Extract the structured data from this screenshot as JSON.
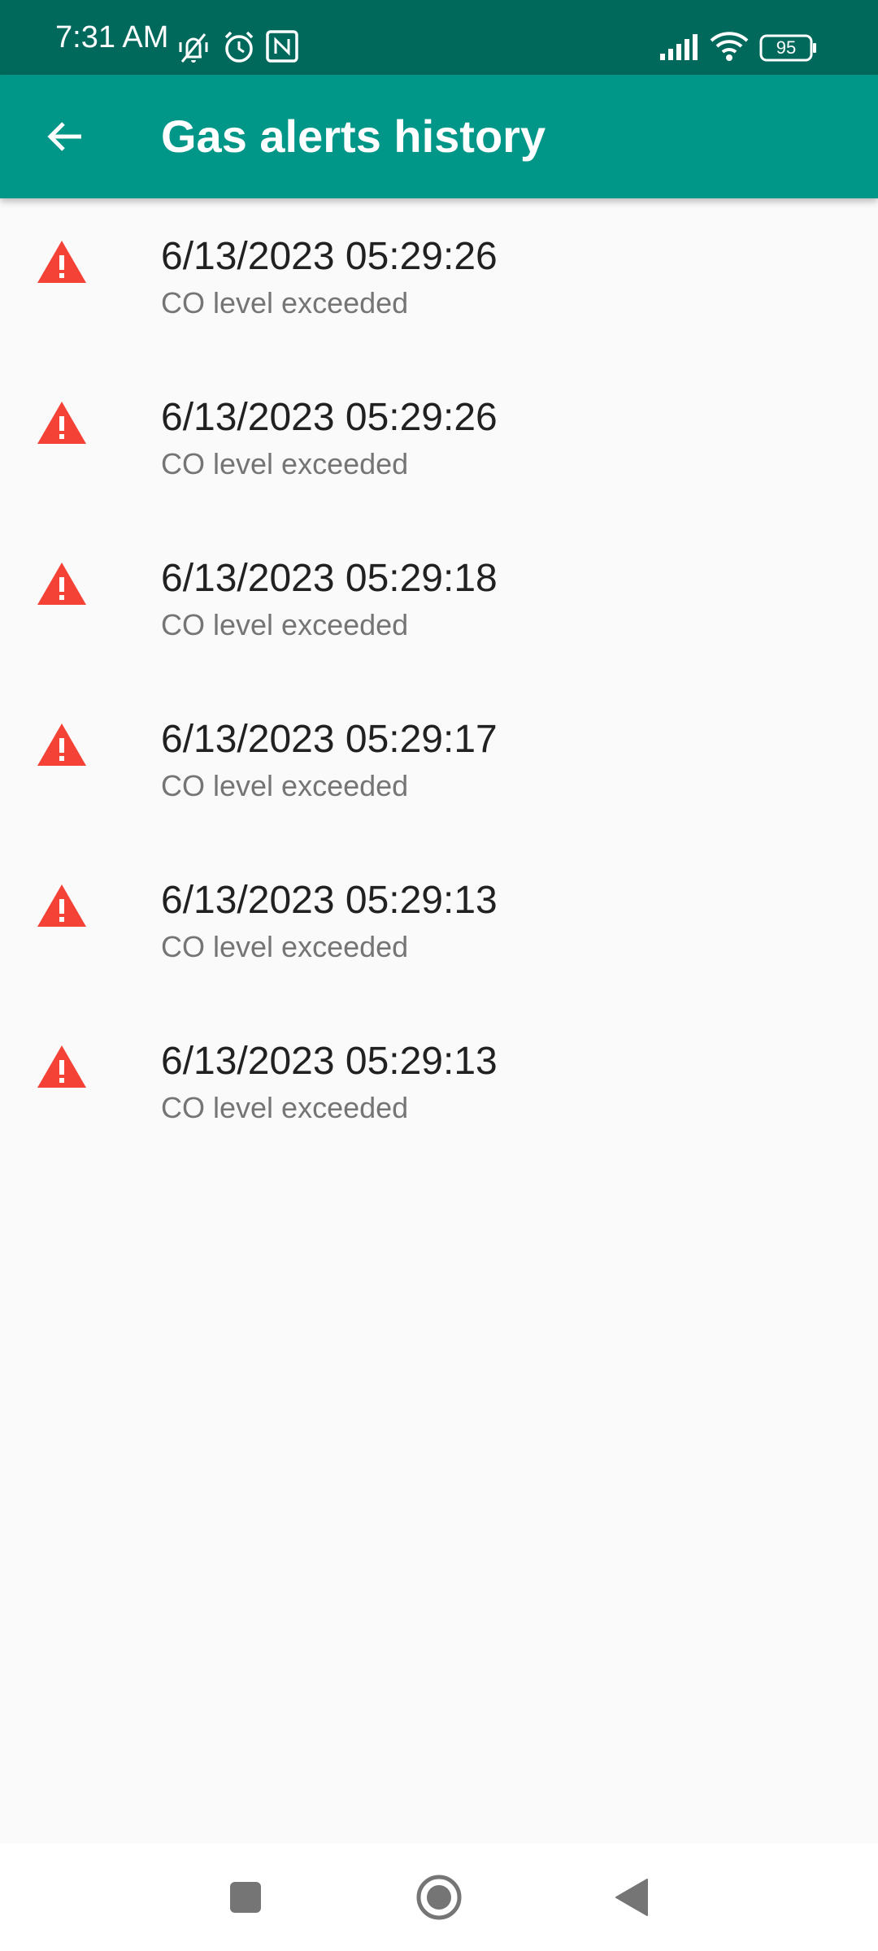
{
  "status_bar": {
    "time": "7:31 AM",
    "battery": "95",
    "icons": [
      "mute-vibrate-icon",
      "alarm-icon",
      "nfc-icon",
      "signal-icon",
      "wifi-icon",
      "battery-icon"
    ]
  },
  "app_bar": {
    "title": "Gas alerts history",
    "back_icon": "arrow-back-icon"
  },
  "alerts": [
    {
      "time": "6/13/2023 05:29:26",
      "message": "CO level exceeded"
    },
    {
      "time": "6/13/2023 05:29:26",
      "message": "CO level exceeded"
    },
    {
      "time": "6/13/2023 05:29:18",
      "message": "CO level exceeded"
    },
    {
      "time": "6/13/2023 05:29:17",
      "message": "CO level exceeded"
    },
    {
      "time": "6/13/2023 05:29:13",
      "message": "CO level exceeded"
    },
    {
      "time": "6/13/2023 05:29:13",
      "message": "CO level exceeded"
    }
  ],
  "nav_bar": {
    "icons": [
      "recents-icon",
      "home-icon",
      "back-icon"
    ]
  },
  "colors": {
    "status_bar": "#00695c",
    "app_bar": "#009688",
    "alert_icon": "#f44336",
    "primary_text": "#212121",
    "secondary_text": "#757575"
  }
}
